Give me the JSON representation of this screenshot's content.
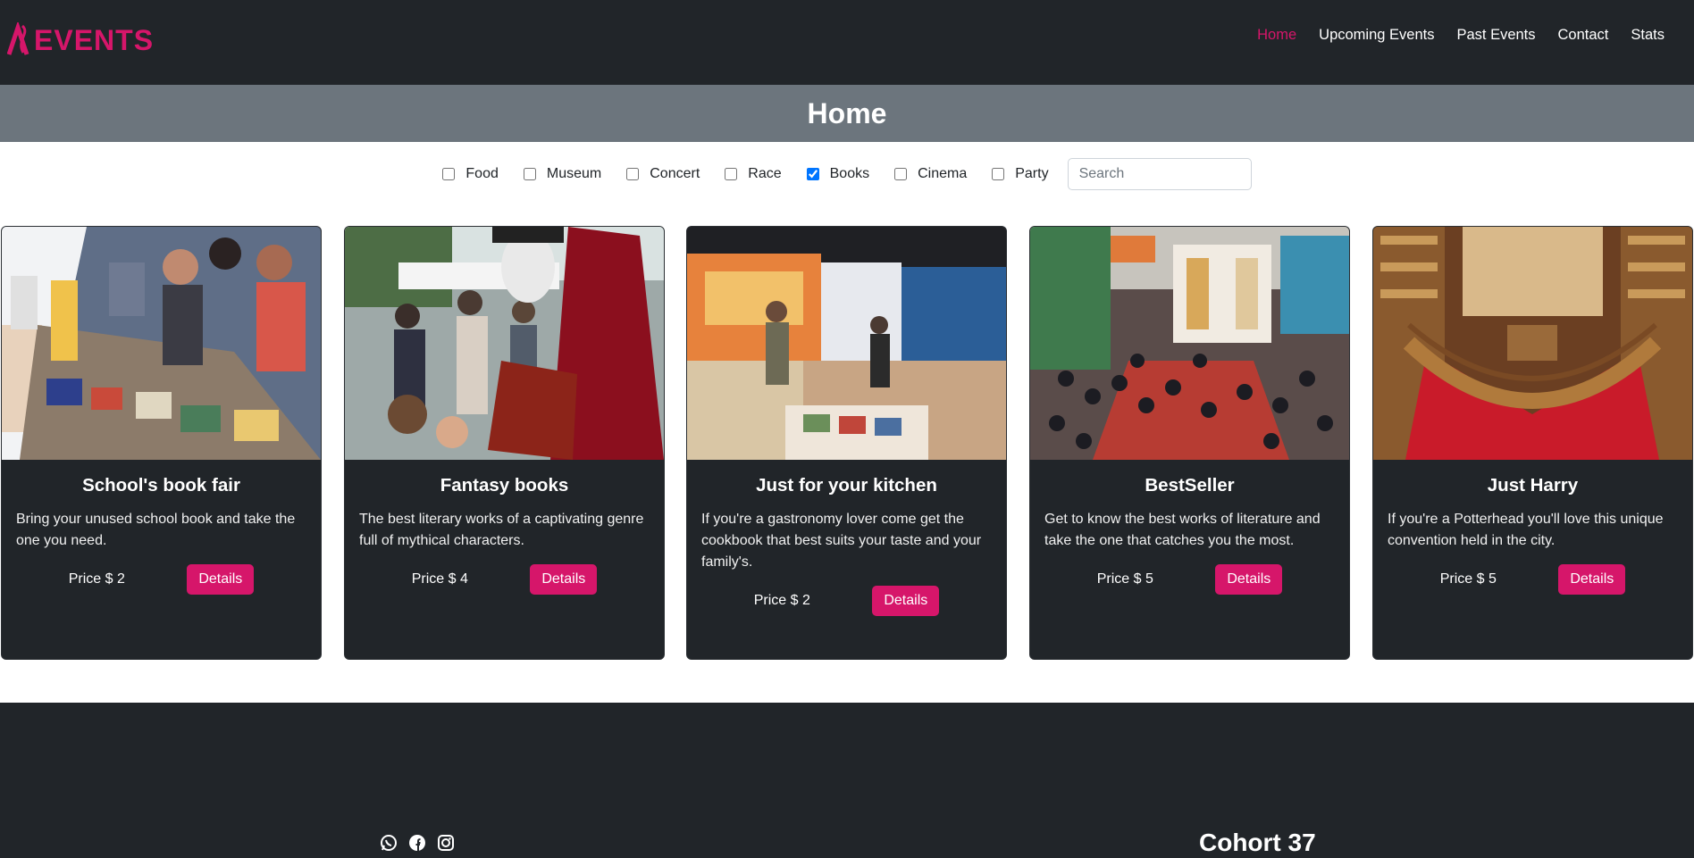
{
  "brand": {
    "logo_text": "EVENTS",
    "logo_initial": "A",
    "accent": "#d6166a"
  },
  "nav": {
    "home": "Home",
    "upcoming": "Upcoming Events",
    "past": "Past Events",
    "contact": "Contact",
    "stats": "Stats"
  },
  "page_title": "Home",
  "filters": {
    "items": [
      {
        "label": "Food",
        "checked": false
      },
      {
        "label": "Museum",
        "checked": false
      },
      {
        "label": "Concert",
        "checked": false
      },
      {
        "label": "Race",
        "checked": false
      },
      {
        "label": "Books",
        "checked": true
      },
      {
        "label": "Cinema",
        "checked": false
      },
      {
        "label": "Party",
        "checked": false
      }
    ],
    "search_placeholder": "Search"
  },
  "cards": [
    {
      "title": "School's book fair",
      "description": "Bring your unused school book and take the one you need.",
      "price": "Price $ 2",
      "button": "Details"
    },
    {
      "title": "Fantasy books",
      "description": "The best literary works of a captivating genre full of mythical characters.",
      "price": "Price $ 4",
      "button": "Details"
    },
    {
      "title": "Just for your kitchen",
      "description": "If you're a gastronomy lover come get the cookbook that best suits your taste and your family's.",
      "price": "Price $ 2",
      "button": "Details"
    },
    {
      "title": "BestSeller",
      "description": "Get to know the best works of literature and take the one that catches you the most.",
      "price": "Price $ 5",
      "button": "Details"
    },
    {
      "title": "Just Harry",
      "description": "If you're a Potterhead you'll love this unique convention held in the city.",
      "price": "Price $ 5",
      "button": "Details"
    }
  ],
  "footer": {
    "cohort": "Cohort 37",
    "social_icons": [
      "whatsapp-icon",
      "facebook-icon",
      "instagram-icon"
    ]
  }
}
